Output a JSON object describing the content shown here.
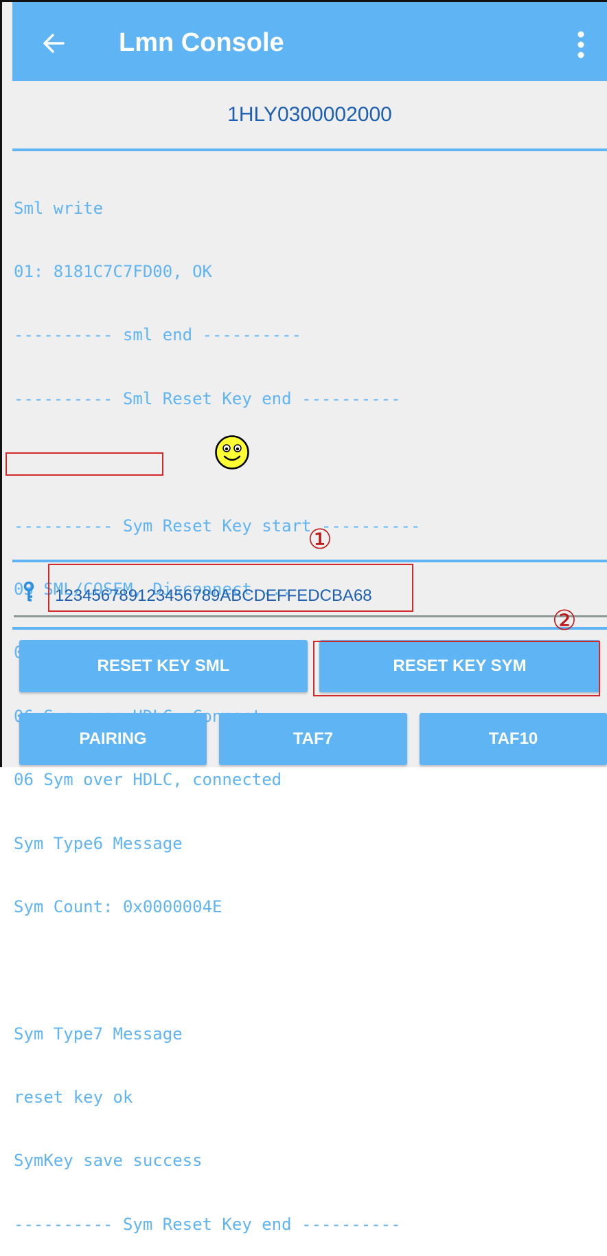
{
  "app": {
    "title": "Lmn Console",
    "accent_color": "#5fb4f3",
    "back_icon": "arrow-left-icon",
    "menu_icon": "more-vert-icon"
  },
  "device": {
    "id": "1HLY0300002000"
  },
  "log": {
    "lines": [
      "Sml write",
      "01: 8181C7C7FD00, OK",
      "---------- sml end ----------",
      "---------- Sml Reset Key end ----------",
      "",
      "---------- Sym Reset Key start ----------",
      "03 SML/COSEM, Disconnect ...",
      "03 SML/COSEM, disconnected",
      "06 Sym over HDLC, Connect ...",
      "06 Sym over HDLC, connected",
      "Sym Type6 Message",
      "Sym Count: 0x0000004E",
      "",
      "Sym Type7 Message",
      "reset key ok",
      "SymKey save success",
      "---------- Sym Reset Key end ----------"
    ]
  },
  "annotations": {
    "marker_1": "①",
    "marker_2": "②",
    "highlight_color": "#d22a2a",
    "smiley_icon": "smiley-face-icon"
  },
  "key_field": {
    "icon": "key-icon",
    "value": "123456789123456789ABCDEFFEDCBA68"
  },
  "buttons": {
    "reset_key_sml": "RESET KEY SML",
    "reset_key_sym": "RESET KEY SYM",
    "pairing": "PAIRING",
    "taf7": "TAF7",
    "taf10": "TAF10"
  }
}
